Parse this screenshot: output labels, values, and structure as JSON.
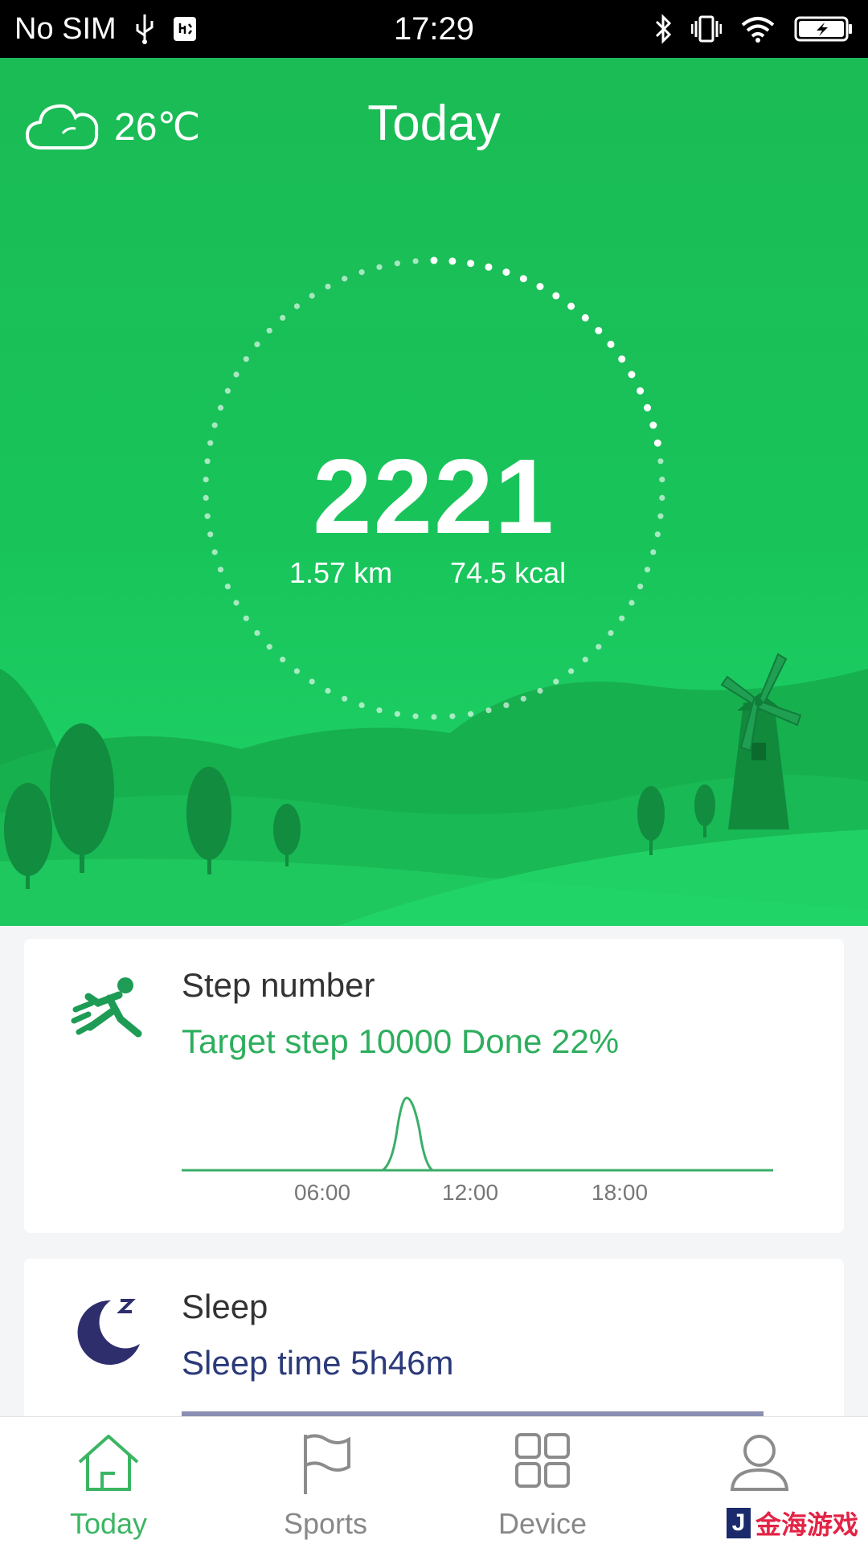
{
  "status_bar": {
    "carrier": "No SIM",
    "time": "17:29",
    "icons": [
      "usb-icon",
      "debug-icon",
      "bluetooth-icon",
      "vibrate-icon",
      "wifi-icon",
      "battery-charging-icon"
    ]
  },
  "header": {
    "weather_icon": "cloud-icon",
    "temperature": "26℃",
    "title": "Today"
  },
  "summary": {
    "steps": "2221",
    "distance": "1.57 km",
    "calories": "74.5 kcal",
    "progress_fraction": 0.22
  },
  "step_card": {
    "icon": "runner-icon",
    "title": "Step number",
    "subtitle": "Target step 10000 Done 22%",
    "ticks": [
      "06:00",
      "12:00",
      "18:00"
    ],
    "accent": "#2eae5e"
  },
  "sleep_card": {
    "icon": "moon-sleep-icon",
    "title": "Sleep",
    "subtitle": "Sleep time 5h46m",
    "accent": "#2b3a7a"
  },
  "nav": {
    "items": [
      {
        "label": "Today",
        "icon": "home-icon",
        "active": true
      },
      {
        "label": "Sports",
        "icon": "flag-icon",
        "active": false
      },
      {
        "label": "Device",
        "icon": "grid-icon",
        "active": false
      },
      {
        "label": "",
        "icon": "user-icon",
        "active": false
      }
    ],
    "active_color": "#3cb563"
  },
  "watermark": {
    "mark": "J",
    "text": "金海游戏"
  }
}
